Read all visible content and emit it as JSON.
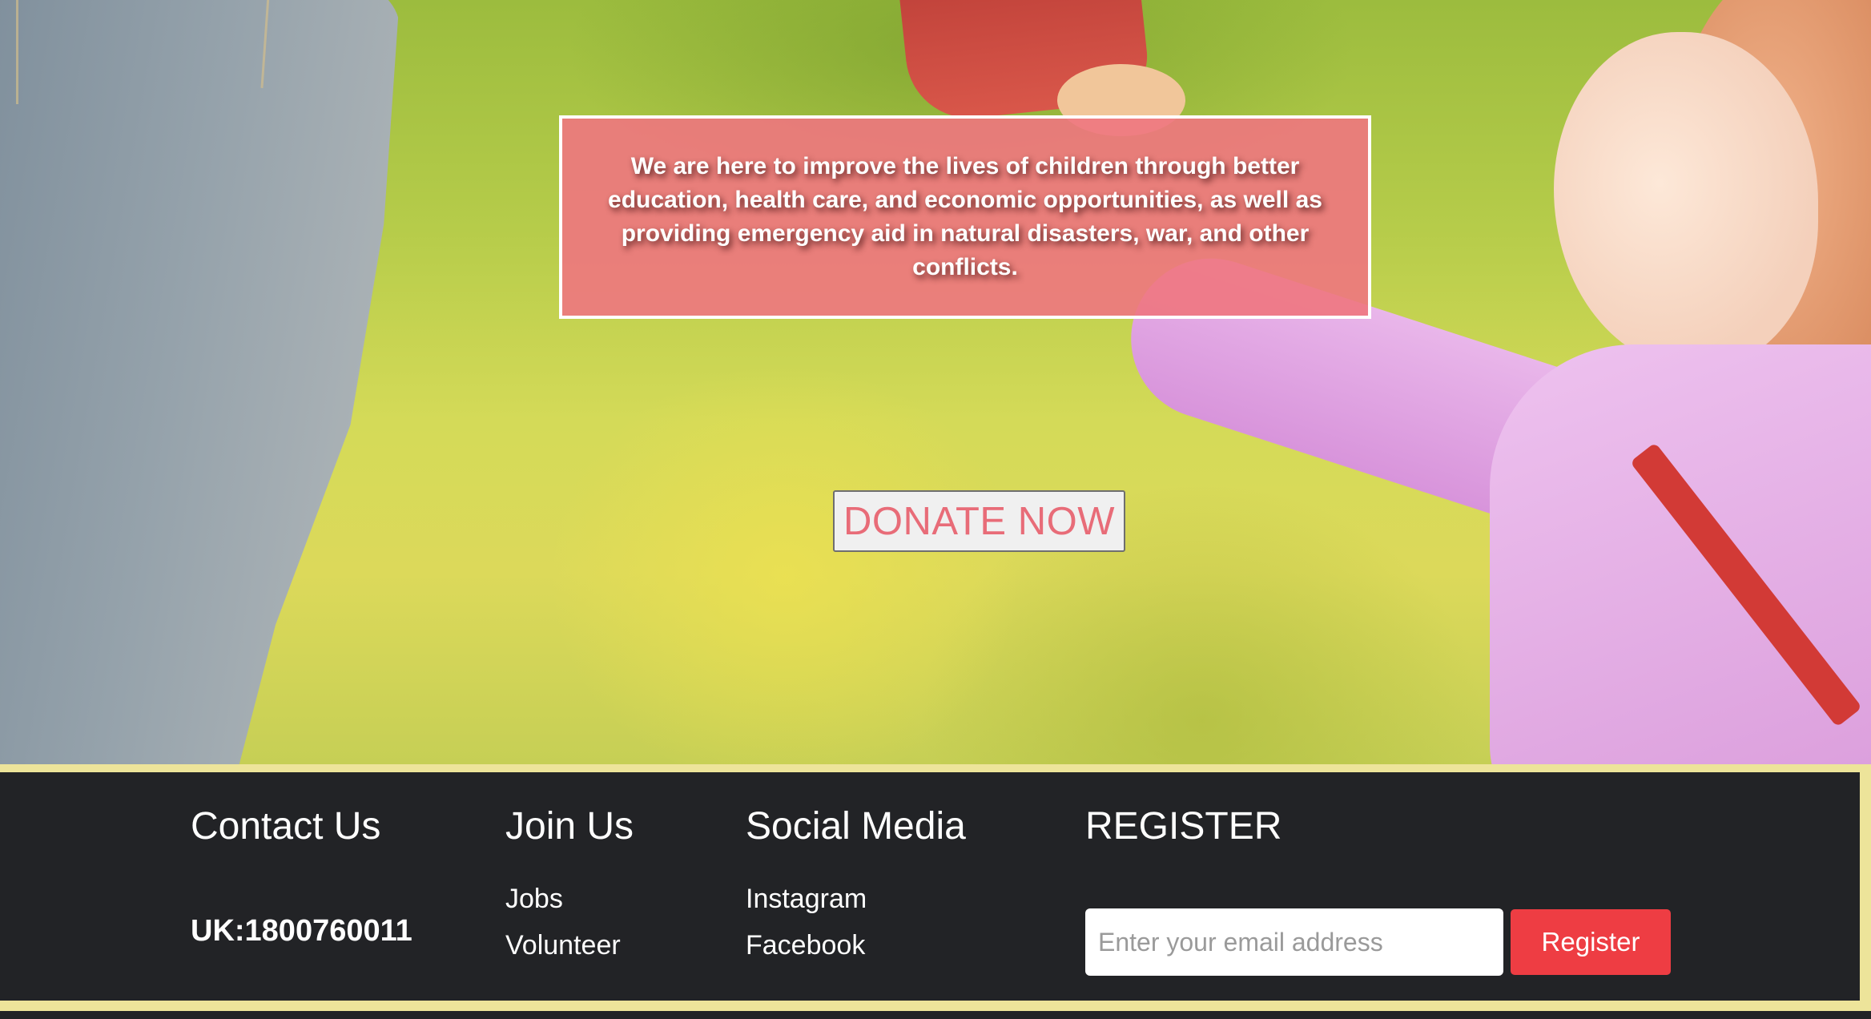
{
  "hero": {
    "mission_text": "We are here to improve the lives of children through better education, health care, and economic opportunities, as well as providing emergency aid in natural disasters, war, and other conflicts.",
    "donate_label": "DONATE NOW"
  },
  "footer": {
    "contact": {
      "heading": "Contact Us",
      "phone": "UK:1800760011"
    },
    "join": {
      "heading": "Join Us",
      "links": [
        "Jobs",
        "Volunteer"
      ]
    },
    "social": {
      "heading": "Social Media",
      "links": [
        "Instagram",
        "Facebook"
      ]
    },
    "register": {
      "heading": "REGISTER",
      "email_placeholder": "Enter your email address",
      "email_value": "",
      "button_label": "Register"
    }
  },
  "colors": {
    "mission_box": "#ee7680",
    "donate_text": "#e86c78",
    "footer_bg": "#222326",
    "footer_frame": "#ede49a",
    "register_button": "#ee3d43"
  }
}
